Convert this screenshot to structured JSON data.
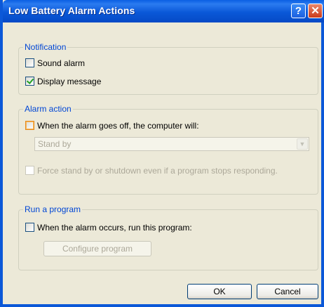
{
  "window": {
    "title": "Low Battery Alarm Actions",
    "help_glyph": "?",
    "close_glyph": "✕"
  },
  "notification": {
    "legend": "Notification",
    "sound_alarm": {
      "label": "Sound alarm",
      "checked": false
    },
    "display_message": {
      "label": "Display message",
      "checked": true
    }
  },
  "alarm_action": {
    "legend": "Alarm action",
    "when_alarm": {
      "label": "When the alarm goes off, the computer will:",
      "checked": false
    },
    "action_select": {
      "value": "Stand by",
      "disabled": true
    },
    "force_standby": {
      "label": "Force stand by or shutdown even if a program stops responding.",
      "checked": false,
      "disabled": true
    }
  },
  "run_program": {
    "legend": "Run a program",
    "when_occurs": {
      "label": "When the alarm occurs, run this program:",
      "checked": false
    },
    "configure_button": {
      "label": "Configure program",
      "disabled": true
    }
  },
  "footer": {
    "ok_label": "OK",
    "cancel_label": "Cancel"
  },
  "colors": {
    "titlebar": "#0a58d8",
    "group_legend": "#0046d5",
    "dialog_bg": "#ece9d8"
  }
}
